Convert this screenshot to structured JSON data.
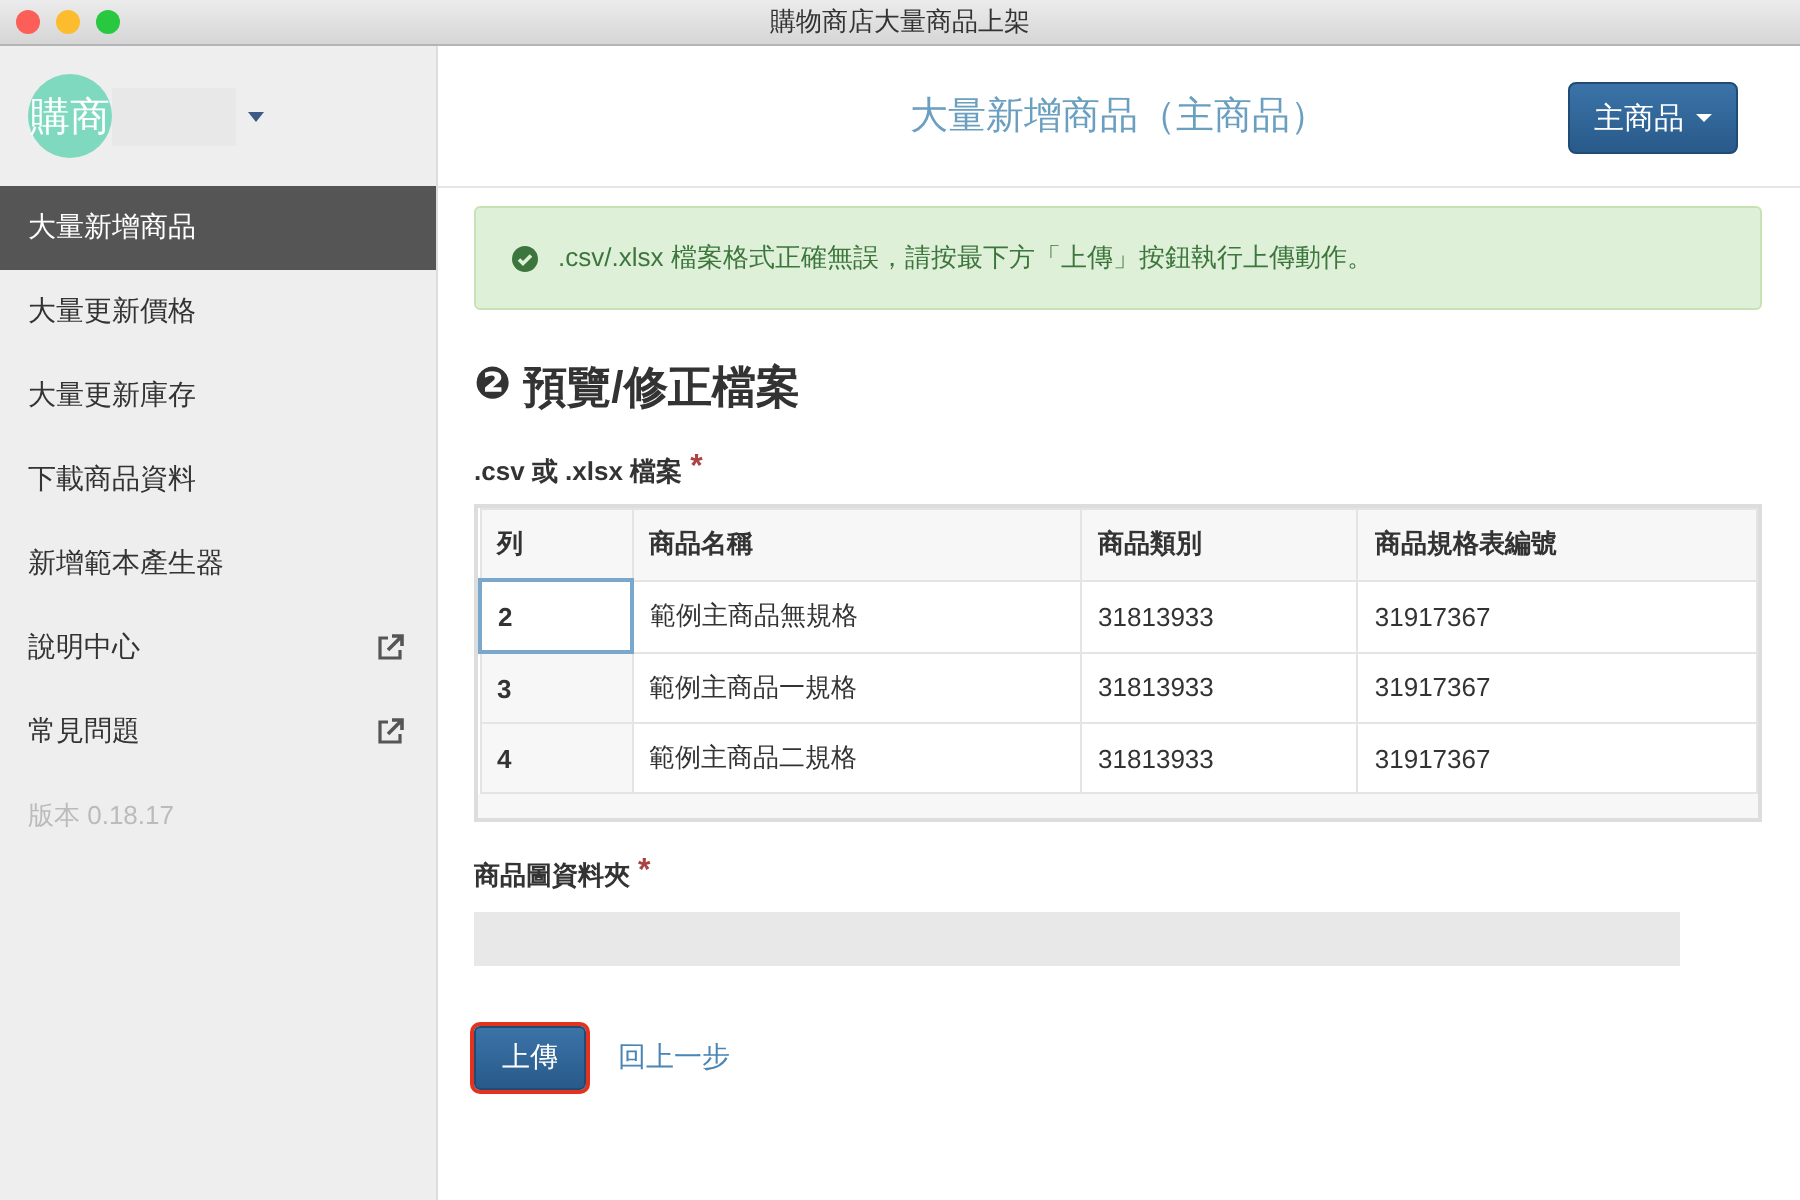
{
  "window": {
    "title": "購物商店大量商品上架"
  },
  "sidebar": {
    "logo": "購商",
    "items": [
      {
        "label": "大量新增商品",
        "selected": true,
        "external": false
      },
      {
        "label": "大量更新價格",
        "selected": false,
        "external": false
      },
      {
        "label": "大量更新庫存",
        "selected": false,
        "external": false
      },
      {
        "label": "下載商品資料",
        "selected": false,
        "external": false
      },
      {
        "label": "新增範本產生器",
        "selected": false,
        "external": false
      },
      {
        "label": "說明中心",
        "selected": false,
        "external": true
      },
      {
        "label": "常見問題",
        "selected": false,
        "external": true
      }
    ],
    "version": "版本 0.18.17"
  },
  "header": {
    "title": "大量新增商品（主商品）",
    "mode_button": "主商品"
  },
  "alert": {
    "text": ".csv/.xlsx 檔案格式正確無誤，請按最下方「上傳」按鈕執行上傳動作。"
  },
  "section": {
    "number": "❷",
    "title": "預覽/修正檔案"
  },
  "file_table": {
    "label": ".csv 或 .xlsx 檔案",
    "required_mark": "*",
    "columns": [
      "列",
      "商品名稱",
      "商品類別",
      "商品規格表編號"
    ],
    "rows": [
      {
        "cells": [
          "2",
          "範例主商品無規格",
          "31813933",
          "31917367"
        ],
        "selected": true
      },
      {
        "cells": [
          "3",
          "範例主商品一規格",
          "31813933",
          "31917367"
        ],
        "selected": false
      },
      {
        "cells": [
          "4",
          "範例主商品二規格",
          "31813933",
          "31917367"
        ],
        "selected": false
      }
    ]
  },
  "image_folder": {
    "label": "商品圖資料夾",
    "required_mark": "*"
  },
  "actions": {
    "upload": {
      "label": "上傳",
      "highlighted": true
    },
    "back": "回上一步"
  }
}
